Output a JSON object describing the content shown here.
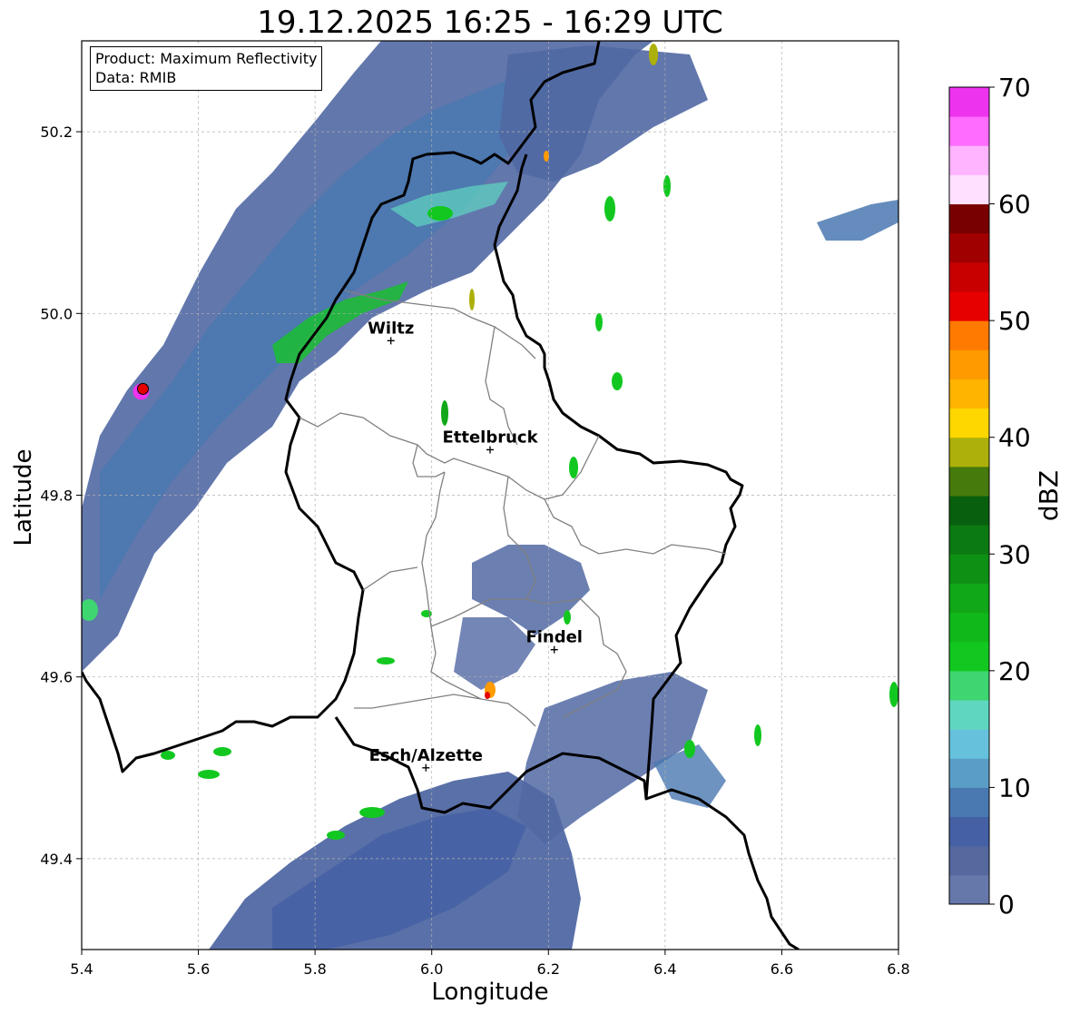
{
  "title": "19.12.2025 16:25 - 16:29 UTC",
  "info": {
    "product": "Product: Maximum Reflectivity",
    "data": "Data: RMIB"
  },
  "axes": {
    "xlabel": "Longitude",
    "ylabel": "Latitude",
    "xlim": [
      5.4,
      6.8
    ],
    "ylim": [
      49.3,
      50.3
    ],
    "xticks": [
      "5.4",
      "5.6",
      "5.8",
      "6.0",
      "6.2",
      "6.4",
      "6.6",
      "6.8"
    ],
    "yticks": [
      "49.4",
      "49.6",
      "49.8",
      "50.0",
      "50.2"
    ],
    "grid": true
  },
  "cities": [
    {
      "name": "Wiltz",
      "lon": 5.93,
      "lat": 49.97
    },
    {
      "name": "Ettelbruck",
      "lon": 6.1,
      "lat": 49.85
    },
    {
      "name": "Findel",
      "lon": 6.21,
      "lat": 49.63
    },
    {
      "name": "Esch/Alzette",
      "lon": 5.99,
      "lat": 49.5
    }
  ],
  "radar_marker": {
    "lon": 5.505,
    "lat": 49.917
  },
  "colorbar": {
    "label": "dBZ",
    "ticks": [
      "0",
      "10",
      "20",
      "30",
      "40",
      "50",
      "60",
      "70"
    ],
    "min": 0,
    "max": 70,
    "colors": [
      "#6677aa",
      "#55699f",
      "#4560a5",
      "#4a78b0",
      "#5a9ec8",
      "#66c2dc",
      "#5fd6c0",
      "#3ed670",
      "#12c820",
      "#10b81a",
      "#10a818",
      "#0e9015",
      "#0b7a12",
      "#08600e",
      "#467a0c",
      "#adb00a",
      "#ffd700",
      "#ffb400",
      "#ff9a00",
      "#ff7a00",
      "#e60000",
      "#c80000",
      "#a00000",
      "#780000",
      "#ffe0ff",
      "#ffb4ff",
      "#ff6cff",
      "#ee33ee"
    ]
  },
  "colors": {
    "border": "#000000",
    "canton": "#808080",
    "grid": "#b0b0b0"
  }
}
